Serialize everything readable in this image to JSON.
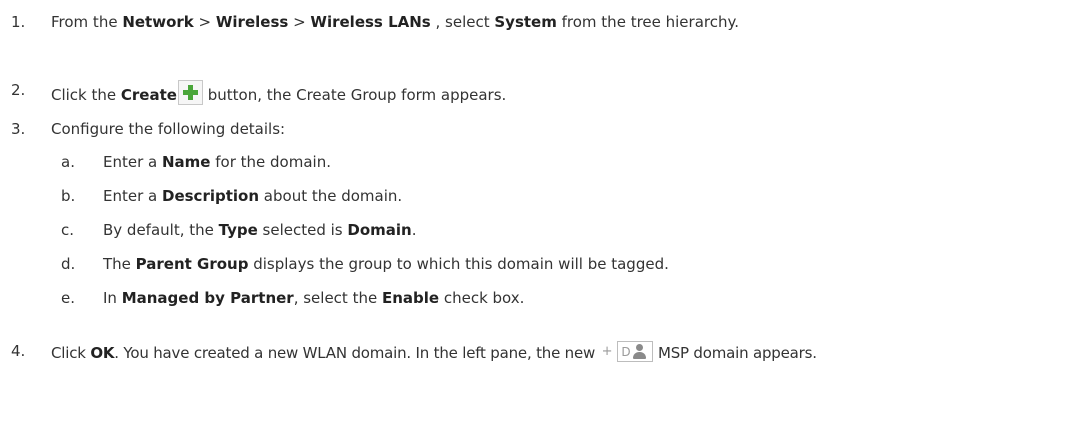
{
  "steps": {
    "s1": {
      "num": "1.",
      "t1": "From the ",
      "b1": "Network",
      "t2": " > ",
      "b2": "Wireless",
      "t3": " > ",
      "b3": "Wireless LANs",
      "t4": " , select ",
      "b4": "System",
      "t5": " from the tree hierarchy."
    },
    "s2": {
      "num": "2.",
      "t1": "Click the ",
      "b1": "Create",
      "t2": " button, the Create Group form appears."
    },
    "s3": {
      "num": "3.",
      "t1": "Configure the following details:",
      "subs": {
        "a": {
          "num": "a.",
          "t1": "Enter a ",
          "b1": "Name",
          "t2": " for the domain."
        },
        "b": {
          "num": "b.",
          "t1": "Enter a ",
          "b1": "Description",
          "t2": " about the domain."
        },
        "c": {
          "num": "c.",
          "t1": "By default, the ",
          "b1": "Type",
          "t2": " selected is ",
          "b2": "Domain",
          "t3": "."
        },
        "d": {
          "num": "d.",
          "t1": "The ",
          "b1": "Parent Group",
          "t2": " displays the group to which this domain will be tagged."
        },
        "e": {
          "num": "e.",
          "t1": "In ",
          "b1": "Managed by Partner",
          "t2": ", select the ",
          "b2": "Enable",
          "t3": " check box."
        }
      }
    },
    "s4": {
      "num": "4.",
      "t1": "Click ",
      "b1": "OK",
      "t2": ". You have created a new WLAN domain. In the left pane, the new",
      "tree_plus": "+",
      "icon_letter": "D",
      "t3": "MSP domain appears."
    }
  }
}
